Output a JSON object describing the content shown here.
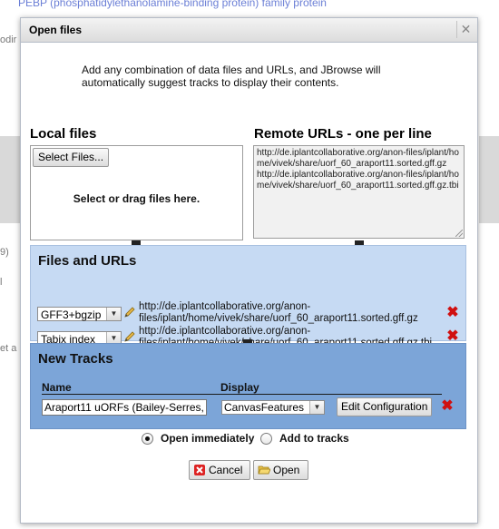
{
  "background": {
    "link_text": "PEBP (phosphatidylethanolamine-binding protein) family protein",
    "fragments": [
      "odir",
      "9)",
      "l",
      "et a"
    ]
  },
  "dialog": {
    "title": "Open files",
    "intro": "Add any combination of data files and URLs, and JBrowse will automatically suggest tracks to display their contents."
  },
  "local_files": {
    "heading": "Local files",
    "select_button": "Select Files...",
    "drop_hint": "Select or drag files here."
  },
  "remote_urls": {
    "heading": "Remote URLs - one per line",
    "value": "http://de.iplantcollaborative.org/anon-files/iplant/home/vivek/share/uorf_60_araport11.sorted.gff.gz\nhttp://de.iplantcollaborative.org/anon-files/iplant/home/vivek/share/uorf_60_araport11.sorted.gff.gz.tbi"
  },
  "files_and_urls": {
    "heading": "Files and URLs",
    "rows": [
      {
        "type": "GFF3+bgzip",
        "url_line1": "http://de.iplantcollaborative.org/anon-",
        "url_line2": "files/iplant/home/vivek/share/uorf_60_araport11.sorted.gff.gz"
      },
      {
        "type": "Tabix index",
        "url_line1": "http://de.iplantcollaborative.org/anon-",
        "url_line2": "files/iplant/home/vivek/share/uorf_60_araport11.sorted.gff.gz.tbi"
      }
    ]
  },
  "new_tracks": {
    "heading": "New Tracks",
    "col_name": "Name",
    "col_display": "Display",
    "track": {
      "name": "Araport11 uORFs (Bailey-Serres,",
      "display": "CanvasFeatures",
      "edit_button": "Edit Configuration"
    }
  },
  "open_mode": {
    "immediately": "Open immediately",
    "add_to_tracks": "Add to tracks",
    "selected": "immediately"
  },
  "buttons": {
    "cancel": "Cancel",
    "open": "Open"
  },
  "colors": {
    "files_section_bg": "#c6daf3",
    "tracks_section_bg": "#7ca5d8",
    "delete_icon": "#d01010"
  }
}
